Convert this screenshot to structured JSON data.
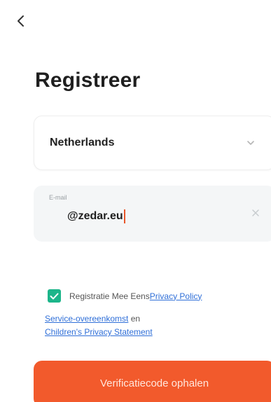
{
  "header": {
    "back_icon": "chevron-left-icon",
    "title": "Registreer"
  },
  "country": {
    "value": "Netherlands",
    "icon": "chevron-down-icon"
  },
  "email": {
    "label": "E-mail",
    "value": "@zedar.eu",
    "clear_icon": "close-icon"
  },
  "agreement": {
    "checked": true,
    "text": "Registratie Mee Eens",
    "privacy_policy": "Privacy Policy",
    "service_agreement": "Service-overeenkomst",
    "conjunction": "en",
    "childrens_privacy": "Children's Privacy Statement"
  },
  "submit": {
    "label": "Verificatiecode ophalen"
  },
  "colors": {
    "accent": "#f25a2c",
    "checkbox": "#1cb58a",
    "link": "#2f6fd8"
  }
}
